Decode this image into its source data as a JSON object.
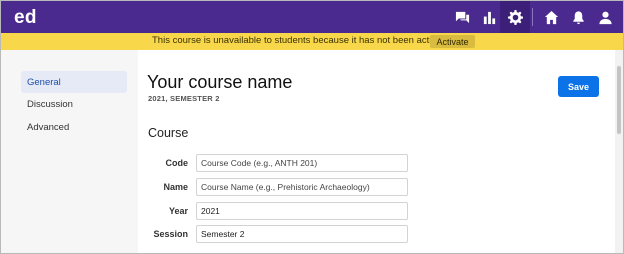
{
  "header": {
    "logo": "ed",
    "icons": [
      "discussion-icon",
      "analytics-icon",
      "settings-icon",
      "home-icon",
      "notifications-icon",
      "profile-icon"
    ]
  },
  "banner": {
    "message": "This course is unavailable to students because it has not been activated.",
    "activate_label": "Activate"
  },
  "sidebar": {
    "items": [
      {
        "label": "General",
        "active": true
      },
      {
        "label": "Discussion",
        "active": false
      },
      {
        "label": "Advanced",
        "active": false
      }
    ]
  },
  "main": {
    "title": "Your course name",
    "subtitle": "2021, SEMESTER 2",
    "save_label": "Save",
    "section_title": "Course",
    "fields": {
      "code": {
        "label": "Code",
        "value": "",
        "placeholder": "Course Code (e.g., ANTH 201)"
      },
      "name": {
        "label": "Name",
        "value": "",
        "placeholder": "Course Name (e.g., Prehistoric Archaeology)"
      },
      "year": {
        "label": "Year",
        "value": "2021"
      },
      "session": {
        "label": "Session",
        "value": "Semester 2"
      }
    }
  },
  "colors": {
    "header": "#4b2a8f",
    "banner": "#f8d74b",
    "accent": "#0b72e7"
  }
}
